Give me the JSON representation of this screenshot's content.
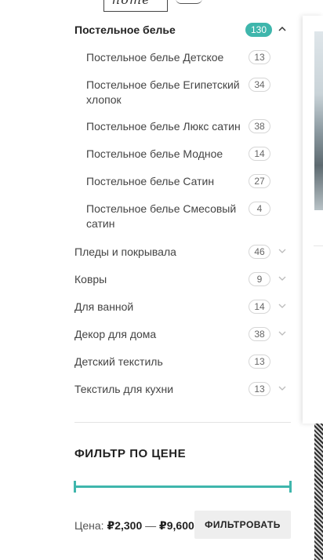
{
  "header": {
    "logo_text": "home"
  },
  "categories": {
    "parent": {
      "label": "Постельное белье",
      "count": "130",
      "accent": "#3fb6ac"
    },
    "children": [
      {
        "label": "Постельное белье Детское",
        "count": "13"
      },
      {
        "label": "Постельное белье Египетский хлопок",
        "count": "34"
      },
      {
        "label": "Постельное белье Люкс сатин",
        "count": "38"
      },
      {
        "label": "Постельное белье Модное",
        "count": "14"
      },
      {
        "label": "Постельное белье Сатин",
        "count": "27"
      },
      {
        "label": "Постельное белье Смесовый сатин",
        "count": "4"
      }
    ],
    "others": [
      {
        "label": "Пледы и покрывала",
        "count": "46",
        "expandable": true
      },
      {
        "label": "Ковры",
        "count": "9",
        "expandable": true
      },
      {
        "label": "Для ванной",
        "count": "14",
        "expandable": true
      },
      {
        "label": "Декор для дома",
        "count": "38",
        "expandable": true
      },
      {
        "label": "Детский текстиль",
        "count": "13",
        "expandable": false
      },
      {
        "label": "Текстиль для кухни",
        "count": "13",
        "expandable": true
      }
    ]
  },
  "price_filter": {
    "title": "ФИЛЬТР ПО ЦЕНЕ",
    "price_label": "Цена:",
    "min": "₽2,300",
    "separator": "—",
    "max": "₽9,600",
    "button_label": "ФИЛЬТРОВАТЬ",
    "range_fill_fraction": 1.0,
    "slider_color": "#3fb6ac"
  },
  "icons": {
    "collapse": "chevron-up-icon",
    "expand": "chevron-down-icon"
  }
}
